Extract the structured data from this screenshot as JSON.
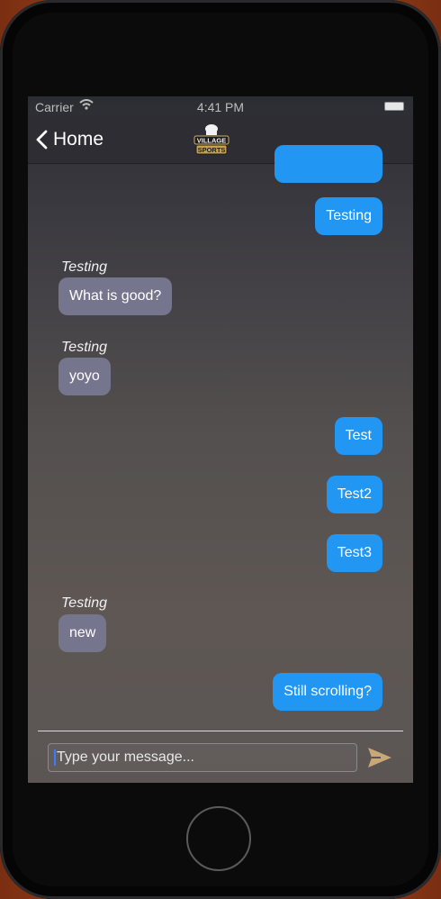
{
  "status": {
    "carrier": "Carrier",
    "time": "4:41 PM"
  },
  "nav": {
    "back_label": "Home",
    "logo_text_top": "VILLAGE",
    "logo_text_bottom": "SPORTS"
  },
  "messages": [
    {
      "kind": "out",
      "text": "Testing"
    },
    {
      "kind": "in",
      "sender": "Testing",
      "text": "What is good?"
    },
    {
      "kind": "in",
      "sender": "Testing",
      "text": "yoyo"
    },
    {
      "kind": "out",
      "text": "Test"
    },
    {
      "kind": "out",
      "text": "Test2"
    },
    {
      "kind": "out",
      "text": "Test3"
    },
    {
      "kind": "in",
      "sender": "Testing",
      "text": "new"
    },
    {
      "kind": "out",
      "text": "Still scrolling?"
    }
  ],
  "composer": {
    "placeholder": "Type your message..."
  },
  "colors": {
    "outgoing": "#2196f3",
    "incoming": "#75758e",
    "send_icon": "#c9a777"
  }
}
